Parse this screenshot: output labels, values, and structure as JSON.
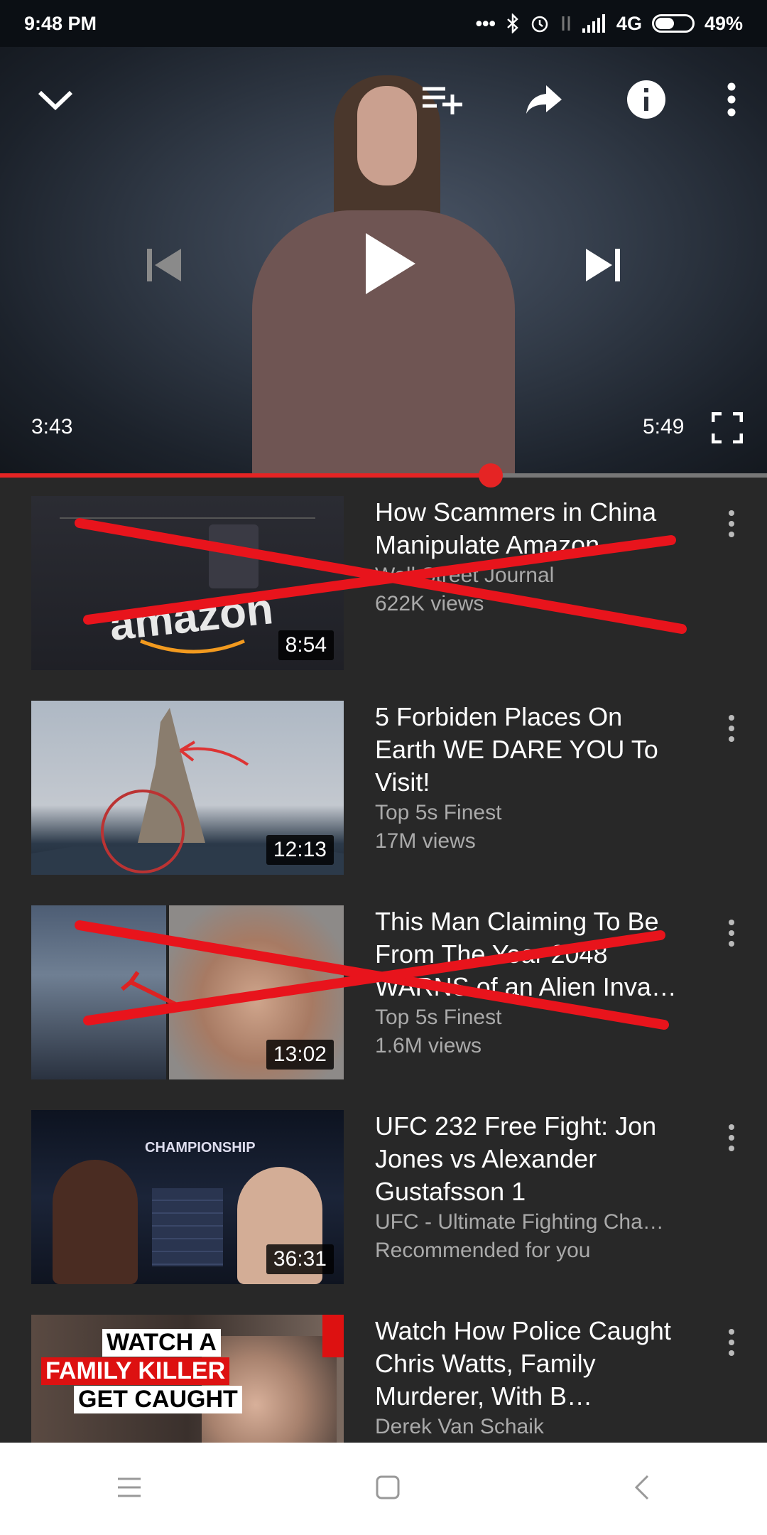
{
  "status_bar": {
    "time": "9:48 PM",
    "network": "4G",
    "battery": "49%"
  },
  "player": {
    "current_time": "3:43",
    "total_time": "5:49",
    "progress_fraction": 0.64,
    "icons": [
      "chevron-down-icon",
      "add-to-playlist-icon",
      "share-icon",
      "info-icon",
      "more-vert-icon",
      "previous-icon",
      "play-icon",
      "next-icon",
      "fullscreen-icon"
    ]
  },
  "videos": [
    {
      "title": "How Scammers in China Manipulate Amazon",
      "channel": "Wall Street Journal",
      "detail": "622K views",
      "duration": "8:54",
      "thumb_text": "amazon",
      "crossed_out": true
    },
    {
      "title": "5 Forbiden Places On Earth WE DARE YOU To Visit!",
      "channel": "Top 5s Finest",
      "detail": "17M views",
      "duration": "12:13",
      "crossed_out": false
    },
    {
      "title": "This Man Claiming To Be From The Year 2048 WARNS of an Alien Inva…",
      "channel": "Top 5s Finest",
      "detail": "1.6M views",
      "duration": "13:02",
      "crossed_out": true
    },
    {
      "title": "UFC 232 Free Fight: Jon Jones vs Alexander Gustafsson 1",
      "channel": "UFC - Ultimate Fighting Cha…",
      "detail": "Recommended for you",
      "duration": "36:31",
      "thumb_text": "CHAMPIONSHIP",
      "crossed_out": false
    },
    {
      "title": "Watch How Police Caught Chris Watts, Family Murderer, With B…",
      "channel": "Derek Van Schaik",
      "detail": "",
      "thumb_lines": [
        "WATCH A",
        "FAMILY KILLER",
        "GET CAUGHT"
      ],
      "crossed_out": false
    }
  ],
  "nav_bar": {
    "icons": [
      "menu-icon",
      "home-icon",
      "back-icon"
    ]
  },
  "colors": {
    "accent": "#e52424",
    "background": "#282828"
  }
}
